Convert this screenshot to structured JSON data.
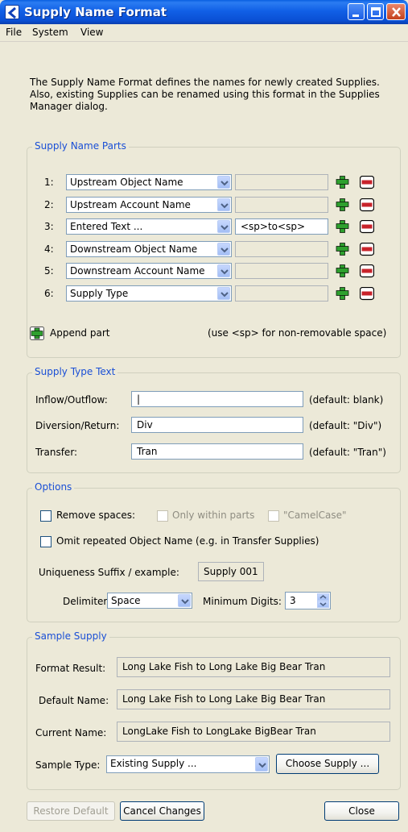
{
  "window": {
    "title": "Supply Name Format"
  },
  "menu": [
    "File",
    "System",
    "View"
  ],
  "intro": [
    "The Supply Name Format defines the names for newly created Supplies.",
    "Also, existing Supplies can be renamed using this format in the Supplies",
    "Manager dialog."
  ],
  "parts": {
    "title": "Supply Name Parts",
    "rows": [
      {
        "num": "1:",
        "type": "Upstream Object Name",
        "text": "",
        "enabled": false
      },
      {
        "num": "2:",
        "type": "Upstream Account Name",
        "text": "",
        "enabled": false
      },
      {
        "num": "3:",
        "type": "Entered Text ...",
        "text": "<sp>to<sp>",
        "enabled": true
      },
      {
        "num": "4:",
        "type": "Downstream Object Name",
        "text": "",
        "enabled": false
      },
      {
        "num": "5:",
        "type": "Downstream Account Name",
        "text": "",
        "enabled": false
      },
      {
        "num": "6:",
        "type": "Supply Type",
        "text": "",
        "enabled": false
      }
    ],
    "append_label": "Append part",
    "hint": "(use <sp> for non-removable space)"
  },
  "supply_type_text": {
    "title": "Supply Type Text",
    "rows": [
      {
        "label": "Inflow/Outflow:",
        "value": "|",
        "default": "(default: blank)"
      },
      {
        "label": "Diversion/Return:",
        "value": "Div",
        "default": "(default: \"Div\")"
      },
      {
        "label": "Transfer:",
        "value": "Tran",
        "default": "(default: \"Tran\")"
      }
    ]
  },
  "options": {
    "title": "Options",
    "remove_spaces": "Remove spaces:",
    "only_within_parts": "Only within parts",
    "camelcase": "\"CamelCase\"",
    "omit_repeated": "Omit repeated Object Name (e.g. in Transfer Supplies)",
    "uniqueness_label": "Uniqueness Suffix / example:",
    "uniqueness_example": "Supply 001",
    "delimiter_label": "Delimiter:",
    "delimiter_value": "Space",
    "min_digits_label": "Minimum Digits:",
    "min_digits_value": "3"
  },
  "sample": {
    "title": "Sample Supply",
    "format_result_label": "Format Result:",
    "format_result": "Long Lake Fish to Long Lake Big Bear Tran",
    "default_name_label": "Default Name:",
    "default_name": "Long Lake Fish to Long Lake Big Bear Tran",
    "current_name_label": "Current Name:",
    "current_name": "LongLake Fish to LongLake BigBear Tran",
    "sample_type_label": "Sample Type:",
    "sample_type_value": "Existing Supply ...",
    "choose_supply": "Choose Supply ..."
  },
  "buttons": {
    "restore_default": "Restore Default",
    "cancel_changes": "Cancel Changes",
    "close": "Close"
  },
  "colors": {
    "title_blue": "#0a4fd4",
    "group_title": "#1a4fd6",
    "plus_green": "#2ea02e",
    "minus_red": "#c8232b"
  }
}
